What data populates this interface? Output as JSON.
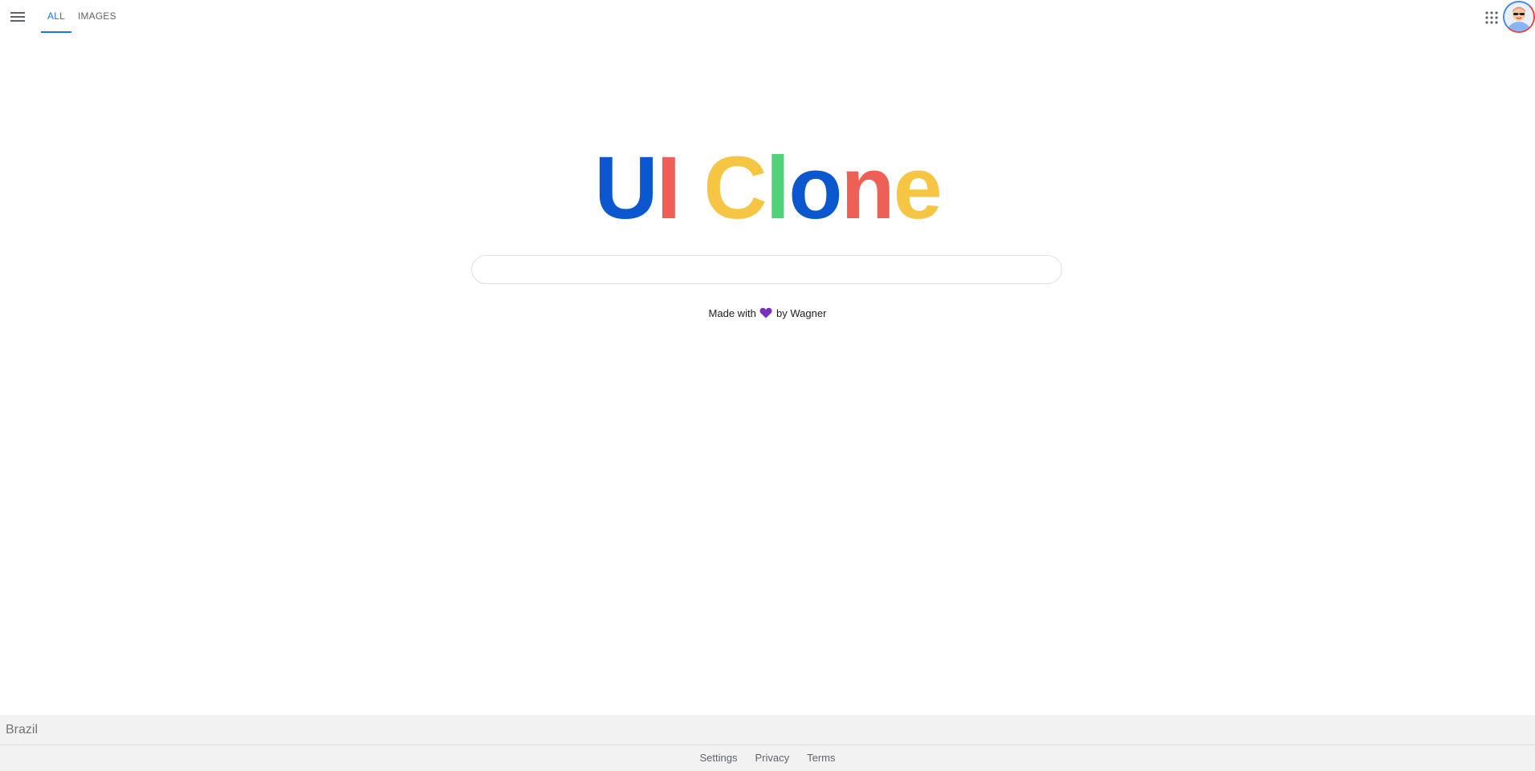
{
  "header": {
    "tabs": [
      {
        "label": "ALL",
        "active": true
      },
      {
        "label": "IMAGES",
        "active": false
      }
    ]
  },
  "logo": {
    "letters": [
      {
        "char": "U",
        "color": "#0b57d0"
      },
      {
        "char": "I",
        "color": "#ee5f56"
      },
      {
        "char": "C",
        "color": "#f6c544"
      },
      {
        "char": "l",
        "color": "#4fd278"
      },
      {
        "char": "o",
        "color": "#0b57d0"
      },
      {
        "char": "n",
        "color": "#ee5f56"
      },
      {
        "char": "e",
        "color": "#f6c544"
      }
    ]
  },
  "search": {
    "value": "",
    "placeholder": ""
  },
  "credit": {
    "prefix": "Made with",
    "icon": "purple-heart-icon",
    "suffix": "by Wagner"
  },
  "footer": {
    "country": "Brazil",
    "links": {
      "settings": "Settings",
      "privacy": "Privacy",
      "terms": "Terms"
    }
  },
  "colors": {
    "accent": "#1a73e8",
    "heart": "#7b2fbf",
    "footer_bg": "#f2f2f2"
  }
}
